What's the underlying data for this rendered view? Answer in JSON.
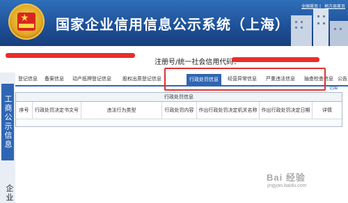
{
  "header": {
    "title": "国家企业信用信息公示系统（上海）",
    "links": [
      "全国首页",
      "地方局首页"
    ]
  },
  "registration": {
    "label": "注册号/统一社会信用代码："
  },
  "sidebar": {
    "panel_label": "工商公示信息",
    "lower_label": "企业"
  },
  "tabs": {
    "items": [
      "登记信息",
      "备案信息",
      "动产抵押登记信息",
      "股权出质登记信息",
      "行政处罚信息",
      "经营异常信息",
      "严重违法信息",
      "抽查检查信息",
      "公告"
    ],
    "active_index": 4,
    "more_label": "范围"
  },
  "table": {
    "caption": "行政处罚信息",
    "columns": [
      "序号",
      "行政处罚决定书文号",
      "违法行为类型",
      "行政处罚内容",
      "作出行政处罚决定机关名称",
      "作出行政处罚决定日期",
      "详情"
    ]
  },
  "watermark": {
    "brand": "Bai 经验",
    "url": "jingyan.baidu.com"
  },
  "colors": {
    "header_blue": "#1d4f96",
    "accent_blue": "#2f66b3",
    "highlight_red": "#e03131",
    "redaction_red": "#ea2d2d"
  }
}
